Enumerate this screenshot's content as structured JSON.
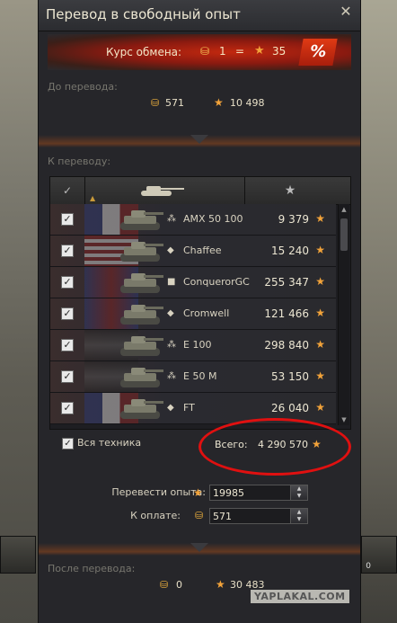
{
  "window": {
    "title": "Перевод в свободный опыт",
    "close_icon": "close-icon"
  },
  "rate": {
    "label": "Курс обмена:",
    "gold": "1",
    "eq": "=",
    "xp": "35",
    "percent_label": "%"
  },
  "before": {
    "label": "До перевода:",
    "gold": "571",
    "xp": "10 498"
  },
  "transfer": {
    "label": "К переводу:"
  },
  "table": {
    "header_check": "✓",
    "header_xp_icon": "★",
    "rows": [
      {
        "type": "⁂",
        "name": "AMX 50 100",
        "xp": "9 379",
        "flag": "france"
      },
      {
        "type": "◆",
        "name": "Chaffee",
        "xp": "15 240",
        "flag": "usa"
      },
      {
        "type": "■",
        "name": "ConquerorGC",
        "xp": "255 347",
        "flag": "uk"
      },
      {
        "type": "◆",
        "name": "Cromwell",
        "xp": "121 466",
        "flag": "uk"
      },
      {
        "type": "⁂",
        "name": "E 100",
        "xp": "298 840",
        "flag": "germany"
      },
      {
        "type": "⁂",
        "name": "E 50 M",
        "xp": "53 150",
        "flag": "germany"
      },
      {
        "type": "◆",
        "name": "FT",
        "xp": "26 040",
        "flag": "france"
      }
    ]
  },
  "all_vehicles": {
    "label": "Вся техника"
  },
  "total": {
    "label": "Всего:",
    "value": "4 290 570"
  },
  "form": {
    "xp_label": "Перевести опыта:",
    "xp_value": "19985",
    "pay_label": "К оплате:",
    "pay_value": "571"
  },
  "after": {
    "label": "После перевода:",
    "gold": "0",
    "xp": "30 483"
  },
  "watermark": "YAPLAKAL.COM",
  "bg_right_number": "0",
  "colors": {
    "accent": "#e03a14",
    "gold": "#f0b23e",
    "xp_star": "#f2a33a",
    "annotation": "#e01010"
  }
}
